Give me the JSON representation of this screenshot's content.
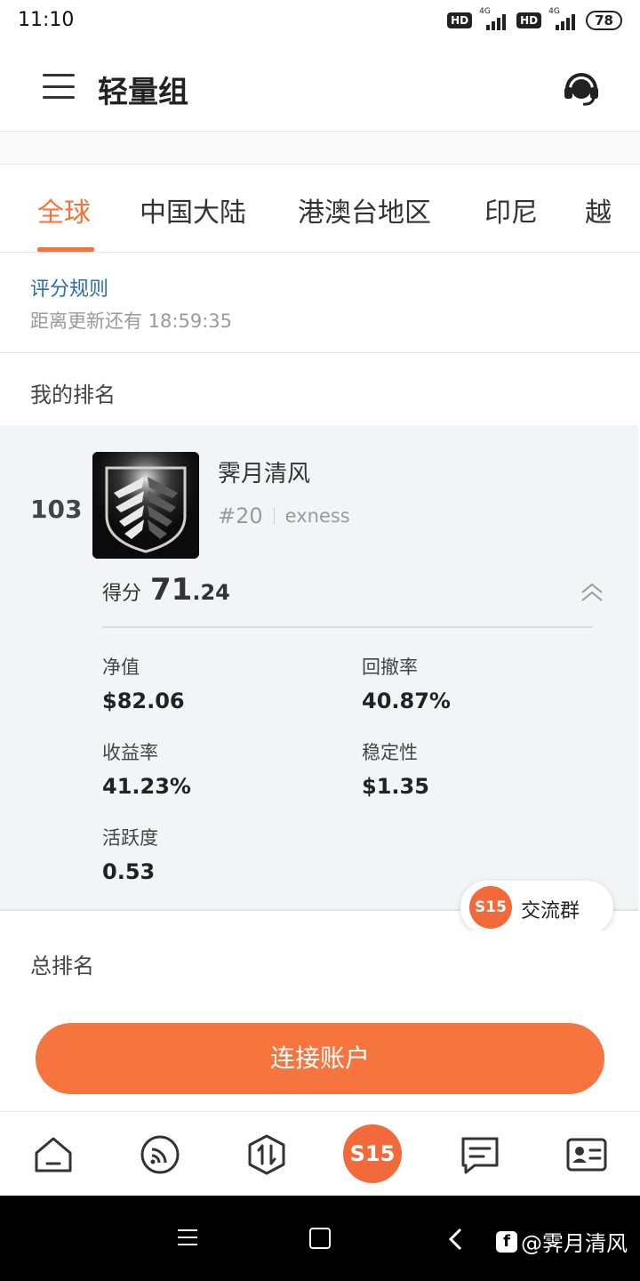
{
  "status_bar": {
    "time": "11:10",
    "hd1": "HD",
    "net1": "4G",
    "hd2": "HD",
    "net2": "4G",
    "battery": "78"
  },
  "header": {
    "title": "轻量组",
    "menu_icon": "hamburger-menu-icon",
    "support_icon": "customer-service-headset-icon"
  },
  "tabs": [
    {
      "label": "全球",
      "active": true
    },
    {
      "label": "中国大陆"
    },
    {
      "label": "港澳台地区"
    },
    {
      "label": "印尼"
    },
    {
      "label": "越"
    }
  ],
  "rules": {
    "link": "评分规则",
    "countdown": "距离更新还有 18:59:35"
  },
  "my_rank": {
    "section_title": "我的排名",
    "rank": "103",
    "name": "霁月清风",
    "tag": "#20",
    "broker": "exness",
    "score_label": "得分",
    "score_int": "71",
    "score_dec": ".24",
    "metrics": {
      "net_value": {
        "label": "净值",
        "value": "$82.06"
      },
      "drawdown": {
        "label": "回撤率",
        "value": "40.87%"
      },
      "return_rate": {
        "label": "收益率",
        "value": "41.23%"
      },
      "stability": {
        "label": "稳定性",
        "value": "$1.35"
      },
      "activity": {
        "label": "活跃度",
        "value": "0.53"
      }
    }
  },
  "group_chip": {
    "badge": "S15",
    "label": "交流群"
  },
  "total_rank": {
    "title": "总排名"
  },
  "connect_button": "连接账户",
  "tabbar": {
    "center_badge": "S15",
    "icons": [
      "home-icon",
      "feed-icon",
      "trade-icon",
      "s15-icon",
      "message-icon",
      "profile-card-icon"
    ]
  },
  "watermark": {
    "logo": "f",
    "text": "@霁月清风"
  },
  "colors": {
    "accent": "#f4733c",
    "link": "#2a6fb0",
    "button": "#f6743e"
  }
}
